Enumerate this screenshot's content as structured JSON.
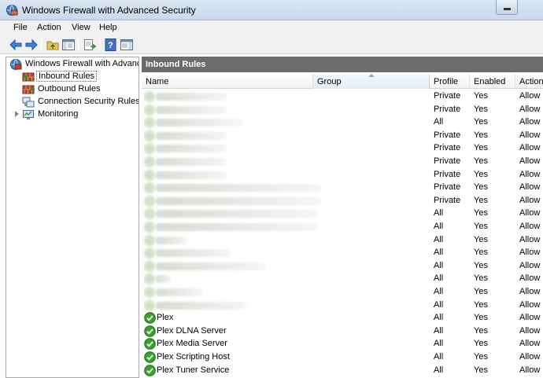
{
  "window": {
    "title": "Windows Firewall with Advanced Security"
  },
  "menu": [
    "File",
    "Action",
    "View",
    "Help"
  ],
  "toolbar": {
    "buttons": [
      "back-arrow-icon",
      "forward-arrow-icon",
      "up-folder-icon",
      "show-hide-tree-icon",
      "export-list-icon",
      "help-icon",
      "show-hide-action-pane-icon"
    ]
  },
  "tree": {
    "root": "Windows Firewall with Advance",
    "items": [
      "Inbound Rules",
      "Outbound Rules",
      "Connection Security Rules",
      "Monitoring"
    ]
  },
  "pane": {
    "title": "Inbound Rules"
  },
  "columns": [
    "Name",
    "Group",
    "Profile",
    "Enabled",
    "Action"
  ],
  "rows": [
    {
      "name": "",
      "profile": "Private",
      "enabled": "Yes",
      "action": "Allow"
    },
    {
      "name": "",
      "profile": "Private",
      "enabled": "Yes",
      "action": "Allow"
    },
    {
      "name": "",
      "profile": "All",
      "enabled": "Yes",
      "action": "Allow"
    },
    {
      "name": "",
      "profile": "Private",
      "enabled": "Yes",
      "action": "Allow"
    },
    {
      "name": "",
      "profile": "Private",
      "enabled": "Yes",
      "action": "Allow"
    },
    {
      "name": "",
      "profile": "Private",
      "enabled": "Yes",
      "action": "Allow"
    },
    {
      "name": "",
      "profile": "Private",
      "enabled": "Yes",
      "action": "Allow"
    },
    {
      "name": "",
      "profile": "Private",
      "enabled": "Yes",
      "action": "Allow"
    },
    {
      "name": "",
      "profile": "Private",
      "enabled": "Yes",
      "action": "Allow"
    },
    {
      "name": "",
      "profile": "All",
      "enabled": "Yes",
      "action": "Allow"
    },
    {
      "name": "",
      "profile": "All",
      "enabled": "Yes",
      "action": "Allow"
    },
    {
      "name": "",
      "profile": "All",
      "enabled": "Yes",
      "action": "Allow"
    },
    {
      "name": "",
      "profile": "All",
      "enabled": "Yes",
      "action": "Allow"
    },
    {
      "name": "",
      "profile": "All",
      "enabled": "Yes",
      "action": "Allow"
    },
    {
      "name": "",
      "profile": "All",
      "enabled": "Yes",
      "action": "Allow"
    },
    {
      "name": "",
      "profile": "All",
      "enabled": "Yes",
      "action": "Allow"
    },
    {
      "name": "",
      "profile": "All",
      "enabled": "Yes",
      "action": "Allow"
    },
    {
      "name": "Plex",
      "profile": "All",
      "enabled": "Yes",
      "action": "Allow"
    },
    {
      "name": "Plex DLNA Server",
      "profile": "All",
      "enabled": "Yes",
      "action": "Allow"
    },
    {
      "name": "Plex Media Server",
      "profile": "All",
      "enabled": "Yes",
      "action": "Allow"
    },
    {
      "name": "Plex Scripting Host",
      "profile": "All",
      "enabled": "Yes",
      "action": "Allow"
    },
    {
      "name": "Plex Tuner Service",
      "profile": "All",
      "enabled": "Yes",
      "action": "Allow"
    }
  ],
  "colors": {
    "pane_header": "#6c6c6c",
    "check_green": "#3aa02e"
  }
}
